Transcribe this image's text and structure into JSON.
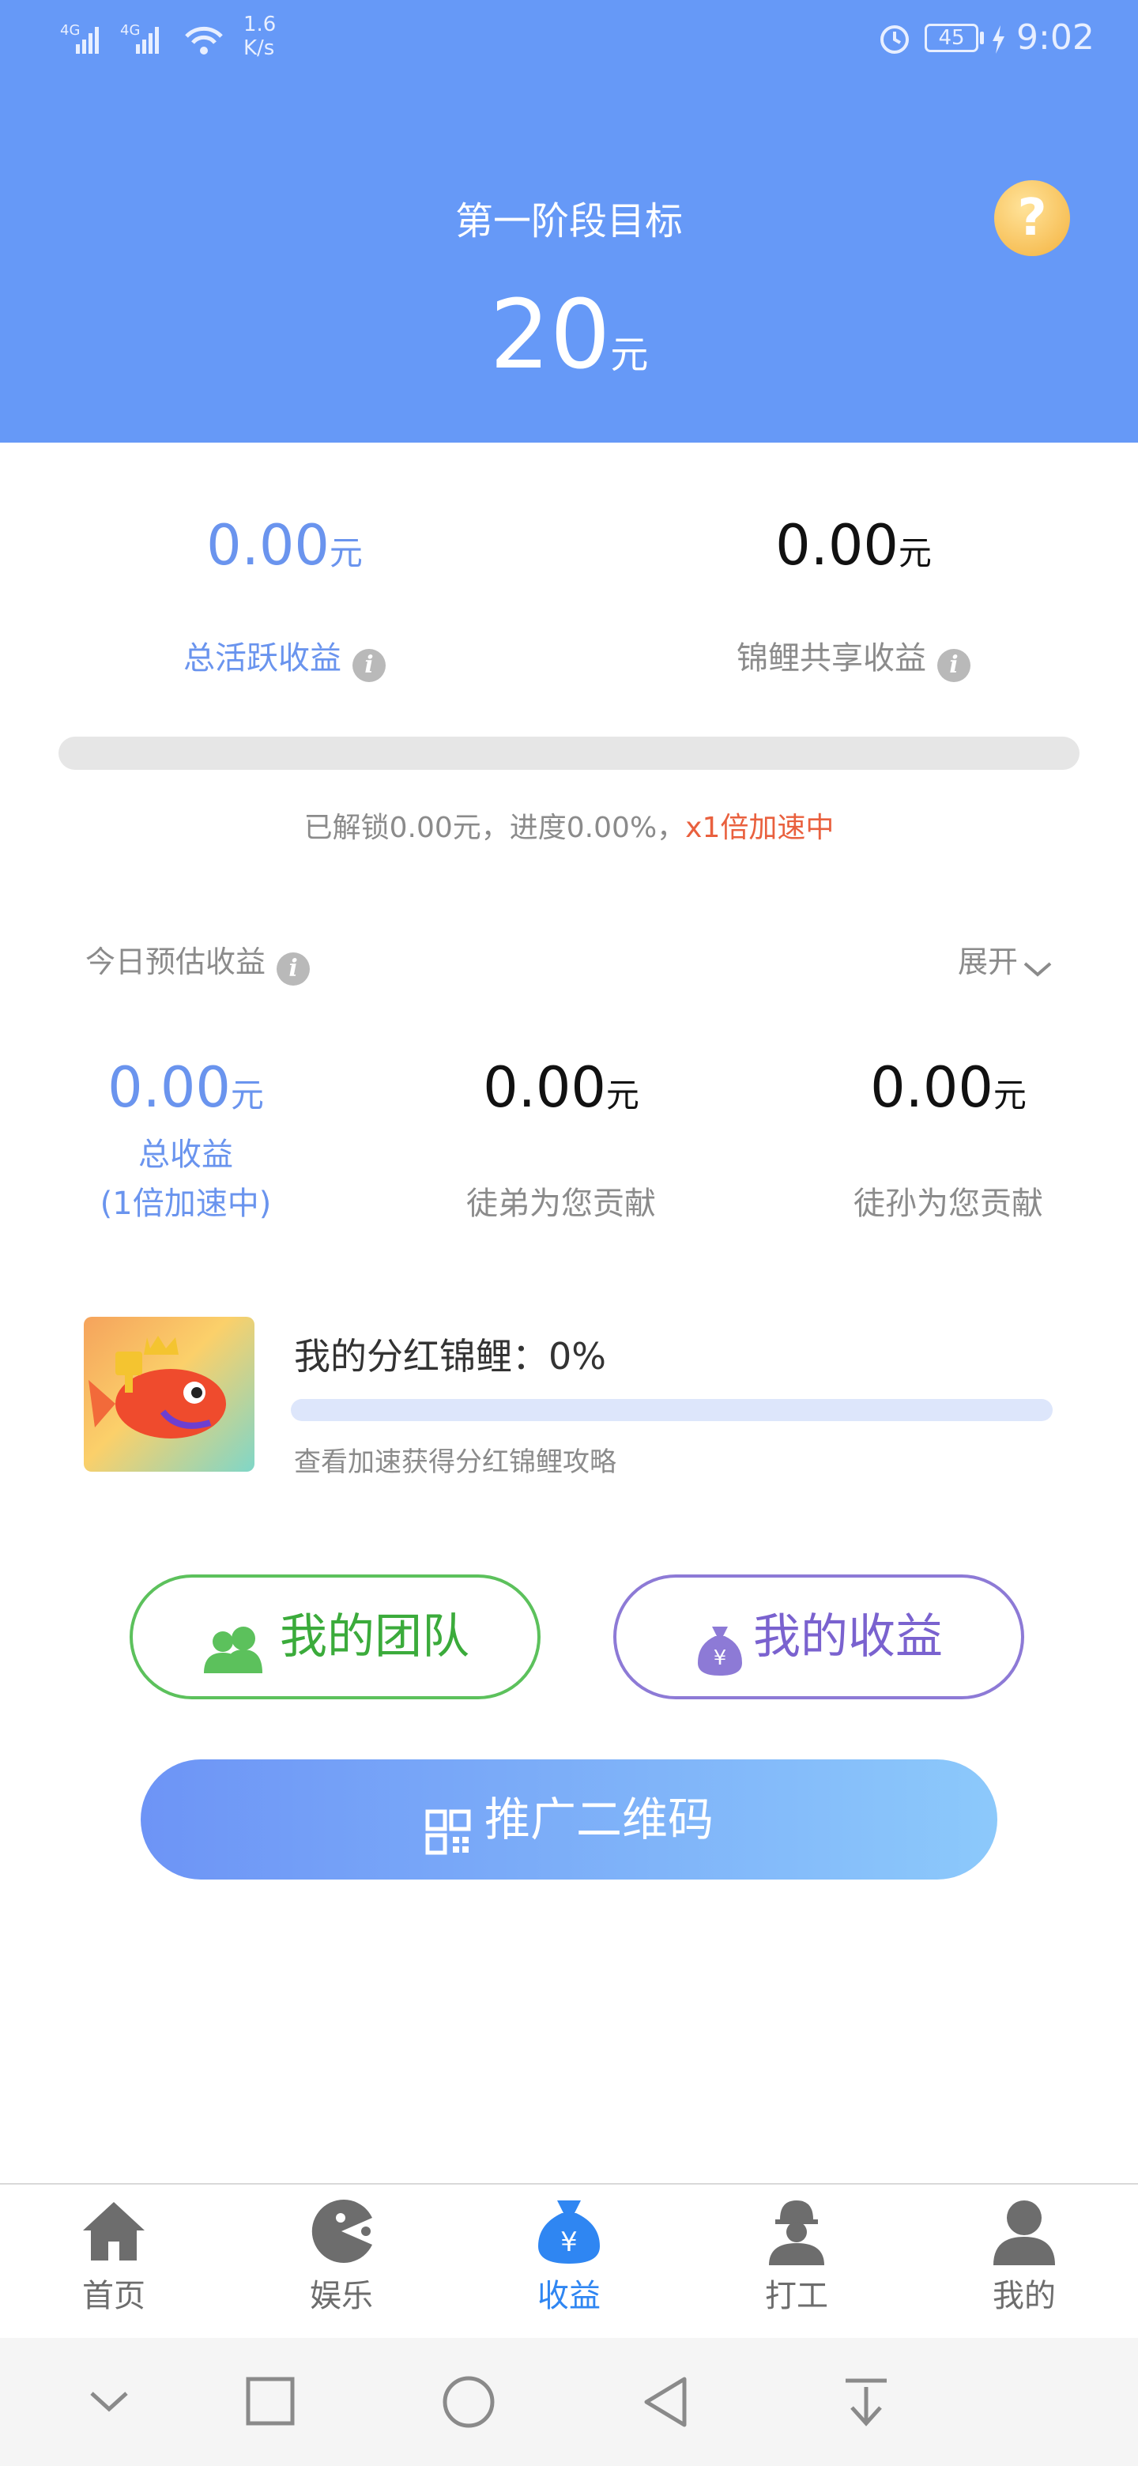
{
  "status_bar": {
    "signal1": "4G",
    "signal2": "4G",
    "speed_value": "1.6",
    "speed_unit": "K/s",
    "battery": "45",
    "time": "9:02"
  },
  "header": {
    "title": "第一阶段目标",
    "amount": "20",
    "unit": "元",
    "help_icon": "question-icon"
  },
  "earnings": {
    "total_active": {
      "value": "0.00",
      "unit": "元",
      "label": "总活跃收益"
    },
    "koi_share": {
      "value": "0.00",
      "unit": "元",
      "label": "锦鲤共享收益"
    }
  },
  "progress": {
    "fraction": 0.0,
    "text_prefix": "已解锁0.00元，进度0.00%，",
    "text_accent": "x1倍加速中"
  },
  "today": {
    "title": "今日预估收益",
    "expand_label": "展开",
    "total": {
      "value": "0.00",
      "unit": "元",
      "label": "总收益",
      "sub": "(1倍加速中)"
    },
    "apprentice": {
      "value": "0.00",
      "unit": "元",
      "label": "徒弟为您贡献"
    },
    "grand_apprentice": {
      "value": "0.00",
      "unit": "元",
      "label": "徒孙为您贡献"
    }
  },
  "koi": {
    "title": "我的分红锦鲤：0%",
    "progress_fraction": 0.0,
    "hint": "查看加速获得分红锦鲤攻略"
  },
  "buttons": {
    "team": "我的团队",
    "income": "我的收益",
    "promo": "推广二维码"
  },
  "nav": [
    {
      "label": "首页",
      "icon": "home-icon"
    },
    {
      "label": "娱乐",
      "icon": "game-icon"
    },
    {
      "label": "收益",
      "icon": "money-bag-icon",
      "active": true
    },
    {
      "label": "打工",
      "icon": "worker-icon"
    },
    {
      "label": "我的",
      "icon": "user-icon"
    }
  ],
  "colors": {
    "header_bg": "#6699f7",
    "accent_blue": "#6a94ee",
    "nav_active": "#2f86f2",
    "team_green": "#5cc15c",
    "income_purple": "#8d7ad6",
    "accent_red": "#e9603e"
  }
}
